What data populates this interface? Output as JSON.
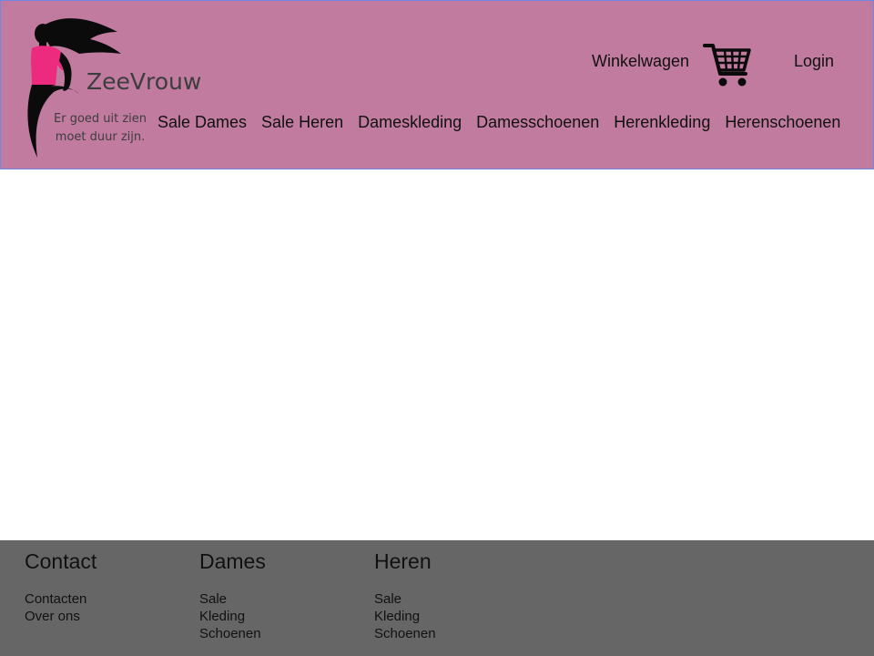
{
  "header": {
    "brand": {
      "name": "ZeeVrouw",
      "tagline_line1": "Er goed uit zien",
      "tagline_line2": "moet duur zijn."
    },
    "cart_label": "Winkelwagen",
    "login_label": "Login",
    "nav": [
      {
        "label": "Sale Dames"
      },
      {
        "label": "Sale Heren"
      },
      {
        "label": "Dameskleding"
      },
      {
        "label": "Damesschoenen"
      },
      {
        "label": "Herenkleding"
      },
      {
        "label": "Herenschoenen"
      }
    ]
  },
  "footer": {
    "columns": [
      {
        "title": "Contact",
        "links": [
          "Contacten",
          "Over ons"
        ]
      },
      {
        "title": "Dames",
        "links": [
          "Sale",
          "Kleding",
          "Schoenen"
        ]
      },
      {
        "title": "Heren",
        "links": [
          "Sale",
          "Kleding",
          "Schoenen"
        ]
      }
    ]
  },
  "colors": {
    "header_bg": "#c17b9f",
    "header_border": "#6f88e6",
    "footer_bg": "#666666",
    "logo_accent": "#ec2a7e"
  },
  "icons": {
    "logo": "woman-silhouette-logo",
    "cart": "shopping-cart-icon"
  }
}
